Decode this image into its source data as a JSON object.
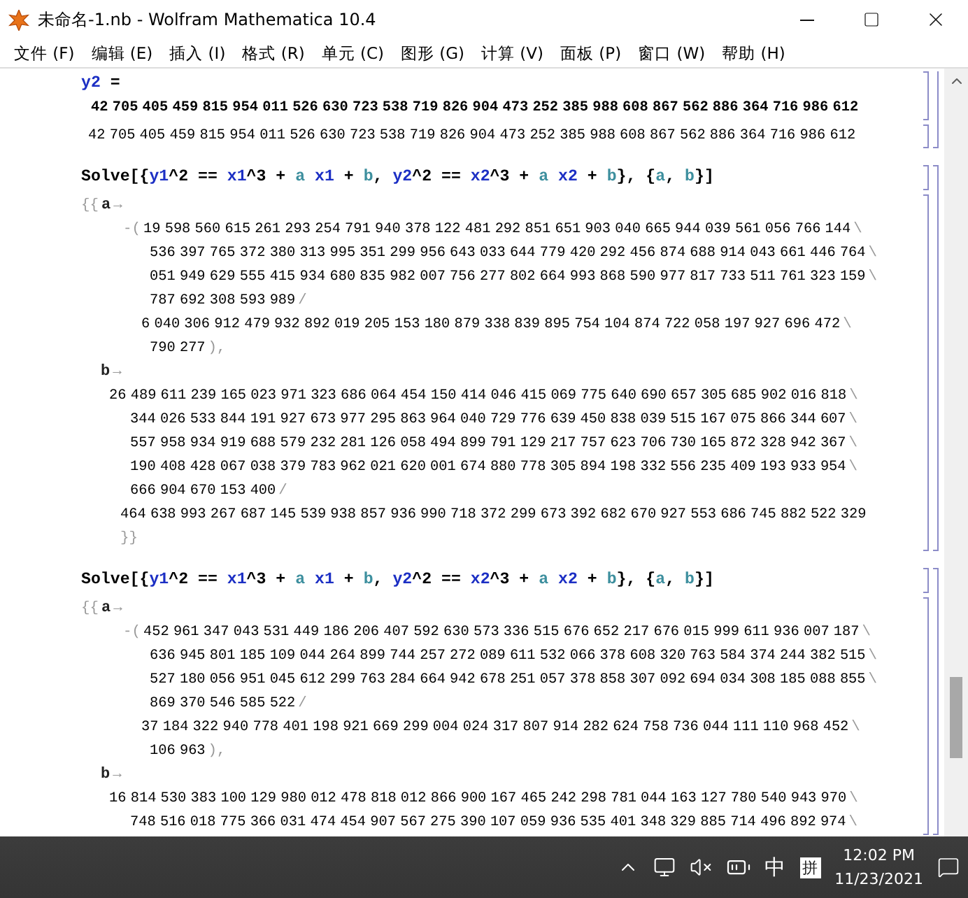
{
  "window": {
    "title": "未命名-1.nb - Wolfram Mathematica 10.4"
  },
  "menu": [
    "文件 (F)",
    "编辑 (E)",
    "插入 (I)",
    "格式 (R)",
    "单元 (C)",
    "图形 (G)",
    "计算 (V)",
    "面板 (P)",
    "窗口 (W)",
    "帮助 (H)"
  ],
  "cells": [
    {
      "kind": "assign",
      "symbol": "y2",
      "op": "=",
      "value": "42 705 405 459 815 954 011 526 630 723 538 719 826 904 473 252 385 988 608 867 562 886 364 716 986 612",
      "output": "42 705 405 459 815 954 011 526 630 723 538 719 826 904 473 252 385 988 608 867 562 886 364 716 986 612"
    },
    {
      "kind": "solve",
      "input": [
        {
          "text": "Solve[{",
          "kind": "plain"
        },
        {
          "text": "y1",
          "kind": "var"
        },
        {
          "text": "^2 == ",
          "kind": "plain"
        },
        {
          "text": "x1",
          "kind": "var"
        },
        {
          "text": "^3 + ",
          "kind": "plain"
        },
        {
          "text": "a",
          "kind": "param"
        },
        {
          "text": " x1",
          "kind": "var"
        },
        {
          "text": " + ",
          "kind": "plain"
        },
        {
          "text": "b",
          "kind": "param"
        },
        {
          "text": ", ",
          "kind": "plain"
        },
        {
          "text": "y2",
          "kind": "var"
        },
        {
          "text": "^2 == ",
          "kind": "plain"
        },
        {
          "text": "x2",
          "kind": "var"
        },
        {
          "text": "^3 + ",
          "kind": "plain"
        },
        {
          "text": "a",
          "kind": "param"
        },
        {
          "text": " x2",
          "kind": "var"
        },
        {
          "text": " + ",
          "kind": "plain"
        },
        {
          "text": "b",
          "kind": "param"
        },
        {
          "text": "}, {",
          "kind": "plain"
        },
        {
          "text": "a",
          "kind": "param"
        },
        {
          "text": ", ",
          "kind": "plain"
        },
        {
          "text": "b",
          "kind": "param"
        },
        {
          "text": "}]",
          "kind": "plain"
        }
      ],
      "output": {
        "open": "{{",
        "close": "}}",
        "rules": [
          {
            "var": "a",
            "arrow": "→",
            "sign": "-(",
            "numerator": [
              {
                "text": "19 598 560 615 261 293 254 791 940 378 122 481 292 851 651 903 040 665 944 039 561 056 766 144",
                "mark": "\\"
              },
              {
                "text": "536 397 765 372 380 313 995 351 299 956 643 033 644 779 420 292 456 874 688 914 043 661 446 764",
                "mark": "\\"
              },
              {
                "text": "051 949 629 555 415 934 680 835 982 007 756 277 802 664 993 868 590 977 817 733 511 761 323 159",
                "mark": "\\"
              },
              {
                "text": "787 692 308 593 989",
                "mark": "/"
              }
            ],
            "denominator": [
              {
                "text": "6 040 306 912 479 932 892 019 205 153 180 879 338 839 895 754 104 874 722 058 197 927 696 472",
                "mark": "\\"
              },
              {
                "text": "790 277",
                "mark": "),"
              }
            ]
          },
          {
            "var": "b",
            "arrow": "→",
            "numerator": [
              {
                "text": "26 489 611 239 165 023 971 323 686 064 454 150 414 046 415 069 775 640 690 657 305 685 902 016 818",
                "mark": "\\"
              },
              {
                "text": "344 026 533 844 191 927 673 977 295 863 964 040 729 776 639 450 838 039 515 167 075 866 344 607",
                "mark": "\\"
              },
              {
                "text": "557 958 934 919 688 579 232 281 126 058 494 899 791 129 217 757 623 706 730 165 872 328 942 367",
                "mark": "\\"
              },
              {
                "text": "190 408 428 067 038 379 783 962 021 620 001 674 880 778 305 894 198 332 556 235 409 193 933 954",
                "mark": "\\"
              },
              {
                "text": "666 904 670 153 400",
                "mark": "/"
              }
            ],
            "denominator": [
              {
                "text": "464 638 993 267 687 145 539 938 857 936 990 718 372 299 673 392 682 670 927 553 686 745 882 522 329"
              }
            ]
          }
        ]
      }
    },
    {
      "kind": "solve",
      "input": [
        {
          "text": "Solve[{",
          "kind": "plain"
        },
        {
          "text": "y1",
          "kind": "var"
        },
        {
          "text": "^2 == ",
          "kind": "plain"
        },
        {
          "text": "x1",
          "kind": "var"
        },
        {
          "text": "^3 + ",
          "kind": "plain"
        },
        {
          "text": "a",
          "kind": "param"
        },
        {
          "text": " x1",
          "kind": "var"
        },
        {
          "text": " + ",
          "kind": "plain"
        },
        {
          "text": "b",
          "kind": "param"
        },
        {
          "text": ", ",
          "kind": "plain"
        },
        {
          "text": "y2",
          "kind": "var"
        },
        {
          "text": "^2 == ",
          "kind": "plain"
        },
        {
          "text": "x2",
          "kind": "var"
        },
        {
          "text": "^3 + ",
          "kind": "plain"
        },
        {
          "text": "a",
          "kind": "param"
        },
        {
          "text": " x2",
          "kind": "var"
        },
        {
          "text": " + ",
          "kind": "plain"
        },
        {
          "text": "b",
          "kind": "param"
        },
        {
          "text": "}, {",
          "kind": "plain"
        },
        {
          "text": "a",
          "kind": "param"
        },
        {
          "text": ", ",
          "kind": "plain"
        },
        {
          "text": "b",
          "kind": "param"
        },
        {
          "text": "}]",
          "kind": "plain"
        }
      ],
      "output": {
        "open": "{{",
        "rules": [
          {
            "var": "a",
            "arrow": "→",
            "sign": "-(",
            "numerator": [
              {
                "text": "452 961 347 043 531 449 186 206 407 592 630 573 336 515 676 652 217 676 015 999 611 936 007 187",
                "mark": "\\"
              },
              {
                "text": "636 945 801 185 109 044 264 899 744 257 272 089 611 532 066 378 608 320 763 584 374 244 382 515",
                "mark": "\\"
              },
              {
                "text": "527 180 056 951 045 612 299 763 284 664 942 678 251 057 378 858 307 092 694 034 308 185 088 855",
                "mark": "\\"
              },
              {
                "text": "869 370 546 585 522",
                "mark": "/"
              }
            ],
            "denominator": [
              {
                "text": "37 184 322 940 778 401 198 921 669 299 004 024 317 807 914 282 624 758 736 044 111 110 968 452",
                "mark": "\\"
              },
              {
                "text": "106 963",
                "mark": "),"
              }
            ]
          },
          {
            "var": "b",
            "arrow": "→",
            "numerator": [
              {
                "text": "16 814 530 383 100 129 980 012 478 818 012 866 900 167 465 242 298 781 044 163 127 780 540 943 970",
                "mark": "\\"
              },
              {
                "text": "748 516 018 775 366 031 474 454 907 567 275 390 107 059 936 535 401 348 329 885 714 496 892 974",
                "mark": "\\"
              }
            ]
          }
        ]
      }
    }
  ],
  "tray": {
    "ime": "中",
    "ime_mode": "拼",
    "time": "12:02 PM",
    "date": "11/23/2021"
  }
}
